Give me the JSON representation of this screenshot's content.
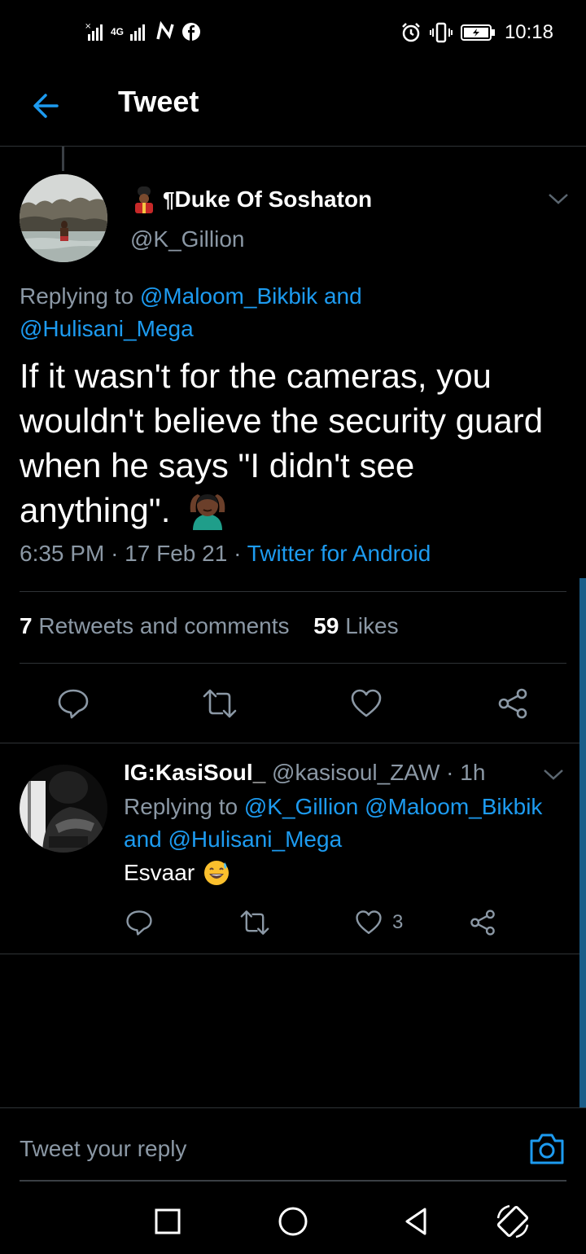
{
  "status_bar": {
    "network": "4G",
    "time": "10:18"
  },
  "app_bar": {
    "title": "Tweet"
  },
  "tweet": {
    "author_name": "Duke Of Soshaton",
    "author_handle": "@K_Gillion",
    "replying_prefix": "Replying to",
    "replying_user1": "@Maloom_Bikbik",
    "replying_and": "and",
    "replying_user2": "@Hulisani_Mega",
    "text": "If it wasn't for the cameras, you wouldn't believe the security guard when he says \"I didn't see anything\".",
    "time": "6:35 PM",
    "date": "17 Feb 21",
    "source": "Twitter for Android",
    "sep": "·"
  },
  "stats": {
    "retweets_count": "7",
    "retweets_label": "Retweets and comments",
    "likes_count": "59",
    "likes_label": "Likes"
  },
  "reply": {
    "name": "IG:KasiSoul_",
    "handle": "@kasisoul_ZAW",
    "time": "1h",
    "replying_prefix": "Replying to",
    "replying_user1": "@K_Gillion",
    "replying_user2": "@Maloom_Bikbik",
    "replying_and": "and",
    "replying_user3": "@Hulisani_Mega",
    "text": "Esvaar",
    "likes_count": "3"
  },
  "compose": {
    "placeholder": "Tweet your reply"
  },
  "colors": {
    "accent": "#1d9bf0",
    "background": "#000000",
    "secondary_text": "#8b98a5"
  }
}
